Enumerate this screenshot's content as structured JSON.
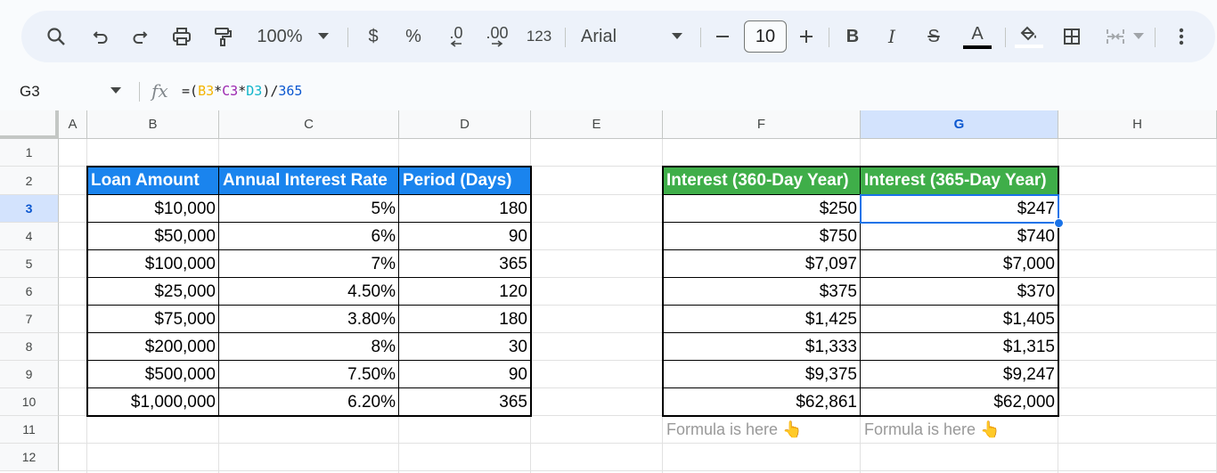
{
  "toolbar": {
    "zoom": "100%",
    "currency": "$",
    "percent": "%",
    "decrease_decimal": ".0",
    "increase_decimal": ".00",
    "more_formats": "123",
    "font": "Arial",
    "font_size": "10",
    "bold": "B",
    "italic": "I",
    "strikethrough": "S",
    "text_color": "A"
  },
  "formula_bar": {
    "name_box": "G3",
    "fx": "fx",
    "formula_parts": [
      "=(",
      "B3",
      "*",
      "C3",
      "*",
      "D3",
      ")/",
      "365"
    ],
    "colors": {
      "ref_b": "#f4b400",
      "ref_c": "#9c27b0",
      "ref_d": "#12b5cb",
      "number": "#0b57d0"
    }
  },
  "columns": [
    "A",
    "B",
    "C",
    "D",
    "E",
    "F",
    "G",
    "H"
  ],
  "rows": [
    "1",
    "2",
    "3",
    "4",
    "5",
    "6",
    "7",
    "8",
    "9",
    "10",
    "11",
    "12"
  ],
  "selected": {
    "column": "G",
    "row": "3"
  },
  "loan_table": {
    "headers": [
      "Loan Amount",
      "Annual Interest Rate",
      "Period (Days)"
    ],
    "rows": [
      [
        "$10,000",
        "5%",
        "180"
      ],
      [
        "$50,000",
        "6%",
        "90"
      ],
      [
        "$100,000",
        "7%",
        "365"
      ],
      [
        "$25,000",
        "4.50%",
        "120"
      ],
      [
        "$75,000",
        "3.80%",
        "180"
      ],
      [
        "$200,000",
        "8%",
        "30"
      ],
      [
        "$500,000",
        "7.50%",
        "90"
      ],
      [
        "$1,000,000",
        "6.20%",
        "365"
      ]
    ],
    "header_color": "#1a84ee"
  },
  "interest_table": {
    "headers": [
      "Interest (360-Day Year)",
      "Interest (365-Day Year)"
    ],
    "rows": [
      [
        "$250",
        "$247"
      ],
      [
        "$750",
        "$740"
      ],
      [
        "$7,097",
        "$7,000"
      ],
      [
        "$375",
        "$370"
      ],
      [
        "$1,425",
        "$1,405"
      ],
      [
        "$1,333",
        "$1,315"
      ],
      [
        "$9,375",
        "$9,247"
      ],
      [
        "$62,861",
        "$62,000"
      ]
    ],
    "header_color": "#3fae49"
  },
  "notes": [
    "Formula is here 👆",
    "Formula is here 👆"
  ]
}
